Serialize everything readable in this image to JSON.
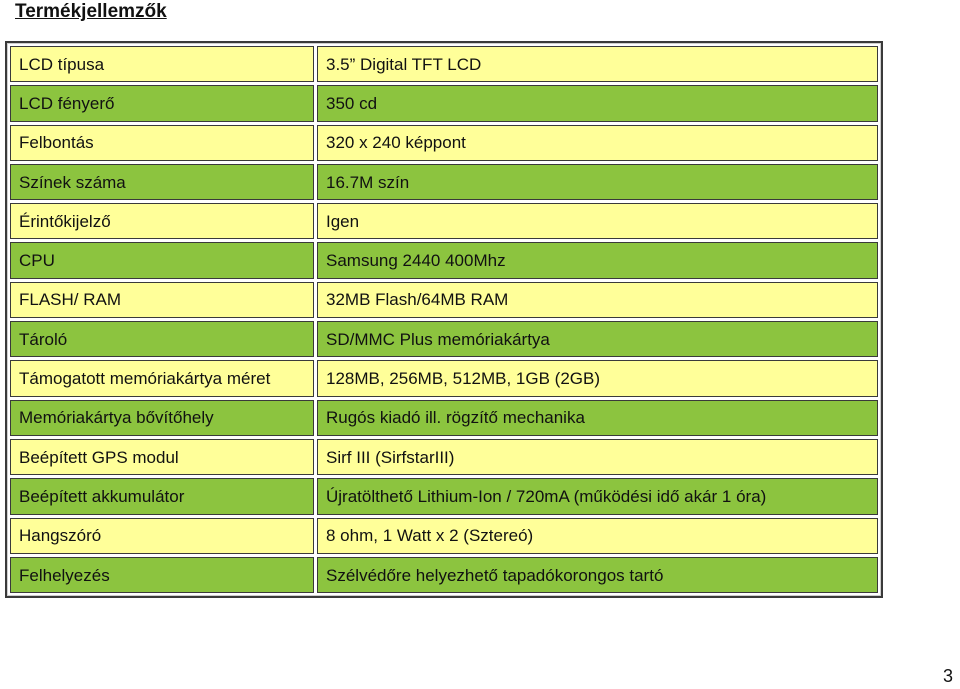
{
  "page": {
    "title": "Termékjellemzők",
    "page_number": "3"
  },
  "colors": {
    "row_light": "#FFFF99",
    "row_dark": "#8CC43F",
    "border": "#3a3a3a"
  },
  "specs": [
    {
      "label": "LCD típusa",
      "value": "3.5” Digital TFT LCD",
      "shade": "light"
    },
    {
      "label": "LCD fényerő",
      "value": "350 cd",
      "shade": "dark"
    },
    {
      "label": "Felbontás",
      "value": "320 x 240 képpont",
      "shade": "light"
    },
    {
      "label": "Színek száma",
      "value": "16.7M szín",
      "shade": "dark"
    },
    {
      "label": "Érintőkijelző",
      "value": "Igen",
      "shade": "light"
    },
    {
      "label": "CPU",
      "value": "Samsung 2440 400Mhz",
      "shade": "dark"
    },
    {
      "label": "FLASH/ RAM",
      "value": "32MB Flash/64MB RAM",
      "shade": "light"
    },
    {
      "label": "Tároló",
      "value": "SD/MMC Plus memóriakártya",
      "shade": "dark"
    },
    {
      "label": "Támogatott memóriakártya méret",
      "value": "128MB, 256MB, 512MB, 1GB (2GB)",
      "shade": "light"
    },
    {
      "label": "Memóriakártya bővítőhely",
      "value": "Rugós kiadó ill. rögzítő mechanika",
      "shade": "dark"
    },
    {
      "label": "Beépített GPS modul",
      "value": "Sirf III (SirfstarIII)",
      "shade": "light"
    },
    {
      "label": "Beépített akkumulátor",
      "value": "Újratölthető Lithium-Ion / 720mA (működési idő akár 1 óra)",
      "shade": "dark"
    },
    {
      "label": "Hangszóró",
      "value": "8 ohm, 1 Watt x 2 (Sztereó)",
      "shade": "light"
    },
    {
      "label": "Felhelyezés",
      "value": "Szélvédőre helyezhető tapadókorongos tartó",
      "shade": "dark"
    }
  ]
}
